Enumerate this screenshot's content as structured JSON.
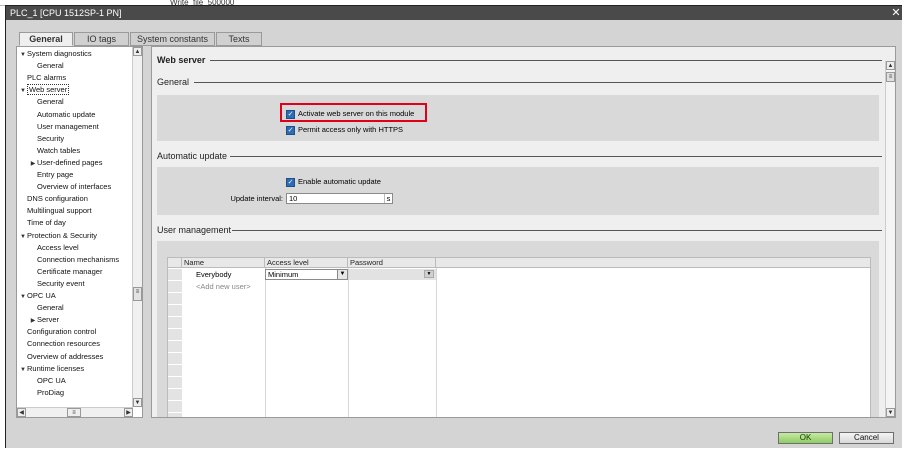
{
  "window": {
    "title": "PLC_1 [CPU 1512SP-1 PN]",
    "background_text": "Write_file_500000",
    "close_label": "✕"
  },
  "tabs": [
    {
      "label": "General",
      "active": true
    },
    {
      "label": "IO tags",
      "active": false
    },
    {
      "label": "System constants",
      "active": false
    },
    {
      "label": "Texts",
      "active": false
    }
  ],
  "tree": {
    "items": [
      {
        "label": "System diagnostics",
        "level": 0,
        "expander": "▼"
      },
      {
        "label": "General",
        "level": 1,
        "expander": ""
      },
      {
        "label": "PLC alarms",
        "level": 0,
        "expander": ""
      },
      {
        "label": "Web server",
        "level": 0,
        "expander": "▼",
        "selected": true
      },
      {
        "label": "General",
        "level": 1,
        "expander": ""
      },
      {
        "label": "Automatic update",
        "level": 1,
        "expander": ""
      },
      {
        "label": "User management",
        "level": 1,
        "expander": ""
      },
      {
        "label": "Security",
        "level": 1,
        "expander": ""
      },
      {
        "label": "Watch tables",
        "level": 1,
        "expander": ""
      },
      {
        "label": "User-defined pages",
        "level": 1,
        "expander": "▶"
      },
      {
        "label": "Entry page",
        "level": 1,
        "expander": ""
      },
      {
        "label": "Overview of interfaces",
        "level": 1,
        "expander": ""
      },
      {
        "label": "DNS configuration",
        "level": 0,
        "expander": ""
      },
      {
        "label": "Multilingual support",
        "level": 0,
        "expander": ""
      },
      {
        "label": "Time of day",
        "level": 0,
        "expander": ""
      },
      {
        "label": "Protection & Security",
        "level": 0,
        "expander": "▼"
      },
      {
        "label": "Access level",
        "level": 1,
        "expander": ""
      },
      {
        "label": "Connection mechanisms",
        "level": 1,
        "expander": ""
      },
      {
        "label": "Certificate manager",
        "level": 1,
        "expander": ""
      },
      {
        "label": "Security event",
        "level": 1,
        "expander": ""
      },
      {
        "label": "OPC UA",
        "level": 0,
        "expander": "▼"
      },
      {
        "label": "General",
        "level": 1,
        "expander": ""
      },
      {
        "label": "Server",
        "level": 1,
        "expander": "▶"
      },
      {
        "label": "Configuration control",
        "level": 0,
        "expander": ""
      },
      {
        "label": "Connection resources",
        "level": 0,
        "expander": ""
      },
      {
        "label": "Overview of addresses",
        "level": 0,
        "expander": ""
      },
      {
        "label": "Runtime licenses",
        "level": 0,
        "expander": "▼"
      },
      {
        "label": "OPC UA",
        "level": 1,
        "expander": ""
      },
      {
        "label": "ProDiag",
        "level": 1,
        "expander": ""
      }
    ]
  },
  "content": {
    "heading": "Web server",
    "general": {
      "title": "General",
      "activate_label": "Activate web server on this module",
      "activate_checked": true,
      "https_label": "Permit access only with HTTPS",
      "https_checked": true
    },
    "auto_update": {
      "title": "Automatic update",
      "enable_label": "Enable automatic update",
      "enable_checked": true,
      "interval_label": "Update interval:",
      "interval_value": "10",
      "interval_unit": "s"
    },
    "user_mgmt": {
      "title": "User management",
      "columns": [
        "Name",
        "Access level",
        "Password"
      ],
      "rows": [
        {
          "name": "Everybody",
          "access": "Minimum",
          "password": ""
        }
      ],
      "add_placeholder": "<Add new user>"
    }
  },
  "footer": {
    "ok_label": "OK",
    "cancel_label": "Cancel"
  },
  "colors": {
    "highlight": "#e0001a",
    "checkbox": "#2d6db5",
    "ok_button": "#8fcc63"
  }
}
